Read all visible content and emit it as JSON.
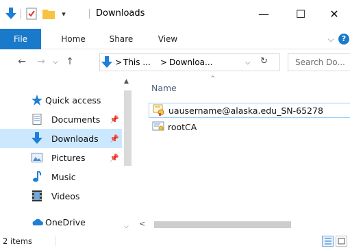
{
  "window": {
    "title": "Downloads",
    "controls": {
      "minimize": "—",
      "maximize": "☐",
      "close": "✕"
    }
  },
  "ribbon": {
    "tabs": [
      "File",
      "Home",
      "Share",
      "View"
    ],
    "expand_glyph": "⌵",
    "help_glyph": "?"
  },
  "address": {
    "segments": [
      "This ...",
      "Downloa..."
    ],
    "separator": ">",
    "search_placeholder": "Search Do..."
  },
  "nav": {
    "items": [
      {
        "label": "Quick access",
        "icon": "star-icon",
        "pinned": false,
        "selected": false
      },
      {
        "label": "Documents",
        "icon": "documents-icon",
        "pinned": true,
        "selected": false
      },
      {
        "label": "Downloads",
        "icon": "download-icon",
        "pinned": true,
        "selected": true
      },
      {
        "label": "Pictures",
        "icon": "pictures-icon",
        "pinned": true,
        "selected": false
      },
      {
        "label": "Music",
        "icon": "music-icon",
        "pinned": false,
        "selected": false
      },
      {
        "label": "Videos",
        "icon": "videos-icon",
        "pinned": false,
        "selected": false
      },
      {
        "label": "OneDrive",
        "icon": "onedrive-icon",
        "pinned": false,
        "selected": false
      }
    ]
  },
  "content": {
    "column_name": "Name",
    "files": [
      {
        "name": "uausername@alaska.edu_SN-65278",
        "icon": "certificate-pfx-icon",
        "focused": true
      },
      {
        "name": "rootCA",
        "icon": "certificate-icon",
        "focused": false
      }
    ]
  },
  "status": {
    "item_count": "2 items"
  },
  "colors": {
    "accent": "#1979ca",
    "selection": "#cce8ff",
    "folder_yellow": "#f6c342",
    "download_blue": "#1f7ed6"
  }
}
